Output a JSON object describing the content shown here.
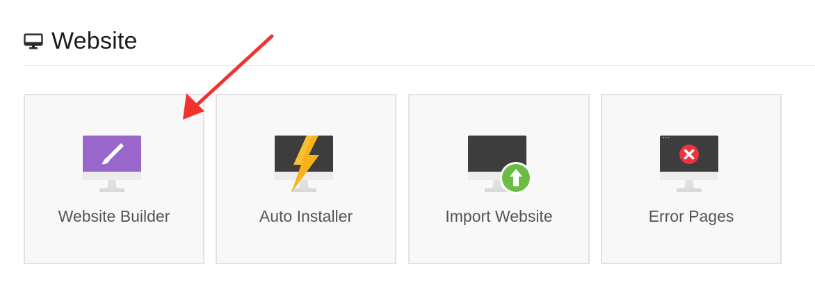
{
  "section": {
    "title": "Website",
    "icon": "monitor-icon"
  },
  "tiles": [
    {
      "label": "Website Builder",
      "icon": "website-builder-icon",
      "color": "#9966cc"
    },
    {
      "label": "Auto Installer",
      "icon": "auto-installer-icon",
      "color": "#f7b21e"
    },
    {
      "label": "Import Website",
      "icon": "import-website-icon",
      "color": "#6cbd45"
    },
    {
      "label": "Error Pages",
      "icon": "error-pages-icon",
      "color": "#ee3340"
    }
  ],
  "colors": {
    "monitor_screen": "#3d3d3d",
    "tile_background": "#f8f8f8",
    "annotation_arrow": "#f0332f"
  }
}
